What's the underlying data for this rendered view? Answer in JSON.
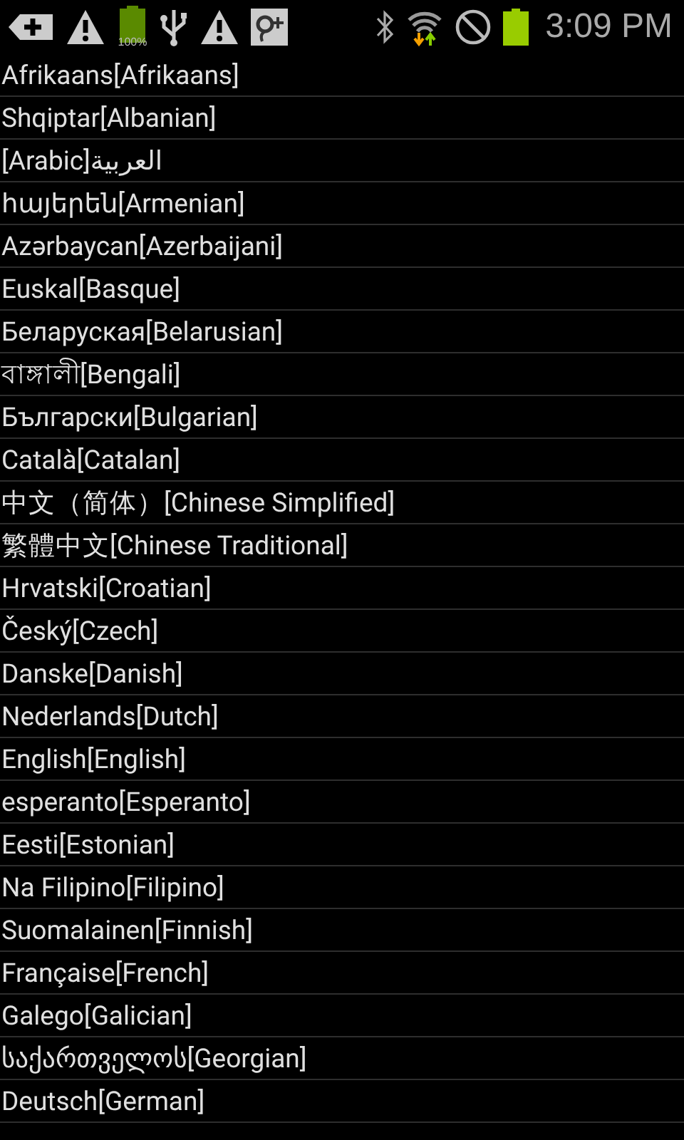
{
  "status_bar": {
    "battery_small_label": "100%",
    "time": "3:09 PM"
  },
  "languages": [
    "Afrikaans[Afrikaans]",
    "Shqiptar[Albanian]",
    "العربية[Arabic]",
    "հայերեն[Armenian]",
    "Azərbaycan[Azerbaijani]",
    "Euskal[Basque]",
    "Беларуская[Belarusian]",
    "বাঙ্গালী[Bengali]",
    "Български[Bulgarian]",
    "Català[Catalan]",
    "中文（简体）[Chinese Simplified]",
    "繁體中文[Chinese Traditional]",
    "Hrvatski[Croatian]",
    "Český[Czech]",
    "Danske[Danish]",
    "Nederlands[Dutch]",
    "English[English]",
    "esperanto[Esperanto]",
    "Eesti[Estonian]",
    "Na Filipino[Filipino]",
    "Suomalainen[Finnish]",
    "Française[French]",
    "Galego[Galician]",
    "საქართველოს[Georgian]",
    "Deutsch[German]"
  ]
}
